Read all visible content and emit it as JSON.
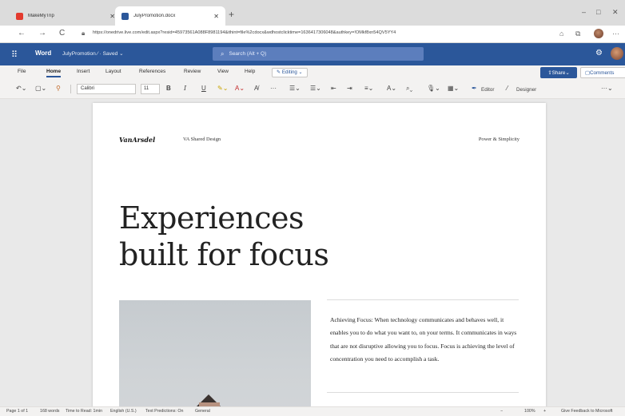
{
  "browser": {
    "tabs": [
      {
        "label": "MakeMyTrip",
        "favicon_color": "#e33a2e"
      },
      {
        "label": "JulyPromotion.docx",
        "favicon_color": "#2b579a"
      }
    ],
    "new_tab": "+",
    "window_controls": [
      "–",
      "□",
      "✕"
    ],
    "nav": {
      "back": "←",
      "forward": "→",
      "reload": "C"
    },
    "url": "https://onedrive.live.com/edit.aspx?resid=45973561A088F8981194&ithint=file%2cdocx&wdhostclicktime=1636417306048&authkey=!OMkf8xn54QV5YY4"
  },
  "word": {
    "app_name": "Word",
    "doc_name": "JulyPromotion",
    "doc_status": "Saved",
    "search_placeholder": "Search (Alt + Q)",
    "accent": "#2b579a"
  },
  "ribbon": {
    "tabs": [
      "File",
      "Home",
      "Insert",
      "Layout",
      "References",
      "Review",
      "View",
      "Help"
    ],
    "active_tab": "Home",
    "mode": "Editing",
    "share": "Share",
    "comments": "Comments"
  },
  "toolbar": {
    "font": "Calibri",
    "size": "11",
    "editor": "Editor",
    "designer": "Designer"
  },
  "document": {
    "logo": "VanArsdel",
    "header_center": "VA Shared Design",
    "header_right": "Power & Simplicity",
    "headline_line1": "Experiences",
    "headline_line2": "built for focus",
    "body": "Achieving Focus: When technology communicates and behaves well, it enables you to do what you want to, on your terms. It communicates in ways that are not disruptive allowing you to focus. Focus is achieving the level of concentration you need to accomplish a task."
  },
  "status": {
    "page": "Page 1 of 1",
    "words": "168 words",
    "read": "Time to Read: 1min",
    "lang": "English (U.S.)",
    "predictions": "Text Predictions: On",
    "general": "General",
    "zoom": "100%",
    "feedback": "Give Feedback to Microsoft"
  }
}
